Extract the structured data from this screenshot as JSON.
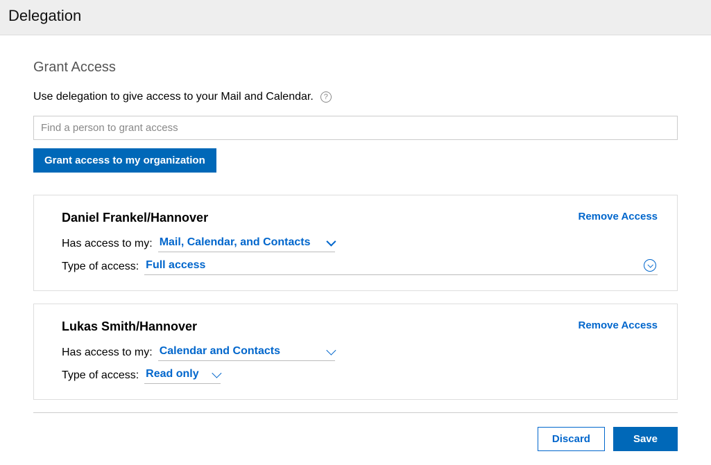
{
  "header": {
    "title": "Delegation"
  },
  "section": {
    "title": "Grant Access",
    "description": "Use delegation to give access to your Mail and Calendar.",
    "search_placeholder": "Find a person to grant access",
    "grant_org_button": "Grant access to my organization"
  },
  "labels": {
    "has_access": "Has access to my:",
    "type_of_access": "Type of access:",
    "remove": "Remove Access"
  },
  "delegates": [
    {
      "name": "Daniel Frankel/Hannover",
      "scope": "Mail, Calendar, and Contacts",
      "access": "Full access"
    },
    {
      "name": "Lukas Smith/Hannover",
      "scope": "Calendar and Contacts",
      "access": "Read only"
    }
  ],
  "footer": {
    "discard": "Discard",
    "save": "Save"
  }
}
